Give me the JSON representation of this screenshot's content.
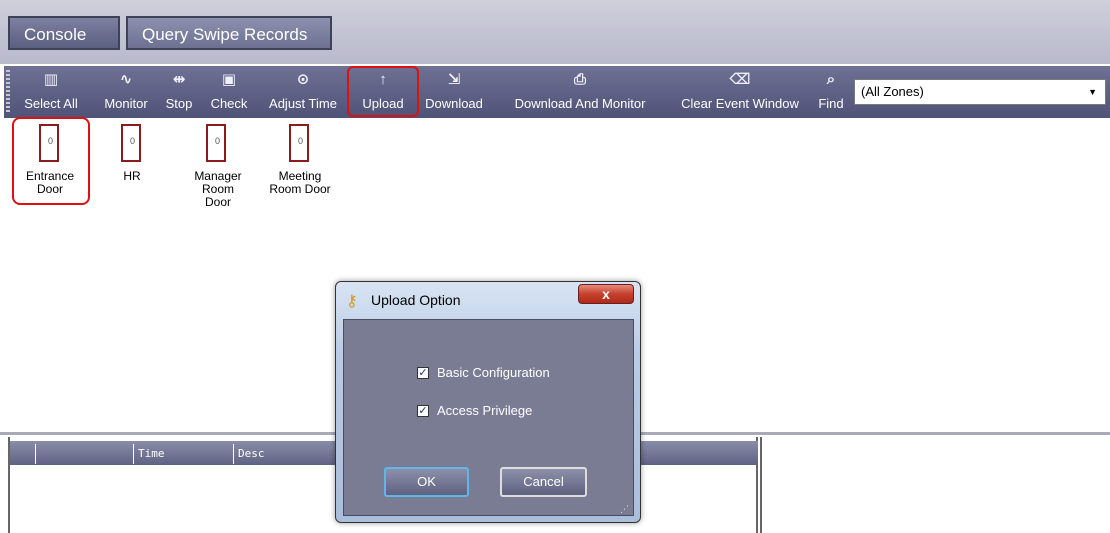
{
  "tabs": [
    {
      "label": "Console"
    },
    {
      "label": "Query Swipe Records"
    }
  ],
  "toolbar": {
    "items": [
      {
        "label": "Select All",
        "icon": "select-all-icon",
        "glyph": "▥"
      },
      {
        "label": "Monitor",
        "icon": "monitor-icon",
        "glyph": "∿"
      },
      {
        "label": "Stop",
        "icon": "stop-icon",
        "glyph": "⇹"
      },
      {
        "label": "Check",
        "icon": "check-icon",
        "glyph": "▣"
      },
      {
        "label": "Adjust Time",
        "icon": "clock-icon",
        "glyph": "⊙"
      },
      {
        "label": "Upload",
        "icon": "upload-arrow-icon",
        "glyph": "↑"
      },
      {
        "label": "Download",
        "icon": "download-icon",
        "glyph": "⇲"
      },
      {
        "label": "Download And Monitor",
        "icon": "download-monitor-icon",
        "glyph": "⎙"
      },
      {
        "label": "Clear Event Window",
        "icon": "trash-icon",
        "glyph": "⌫"
      },
      {
        "label": "Find",
        "icon": "search-icon",
        "glyph": "⌕"
      }
    ],
    "zone_select": "(All Zones)"
  },
  "doors": [
    {
      "count": "0",
      "name": "Entrance Door"
    },
    {
      "count": "0",
      "name": "HR"
    },
    {
      "count": "0",
      "name": "Manager Room  Door"
    },
    {
      "count": "0",
      "name": "Meeting Room Door"
    }
  ],
  "event_table": {
    "columns": [
      "",
      "Time",
      "Desc"
    ]
  },
  "dialog": {
    "title": "Upload Option",
    "close_label": "x",
    "options": [
      {
        "label": "Basic Configuration",
        "checked": true
      },
      {
        "label": "Access Privilege",
        "checked": true
      }
    ],
    "ok_label": "OK",
    "cancel_label": "Cancel"
  },
  "colors": {
    "highlight": "#e01010",
    "toolbar": "#5b5f80",
    "dialog_body": "#7a7c93"
  }
}
